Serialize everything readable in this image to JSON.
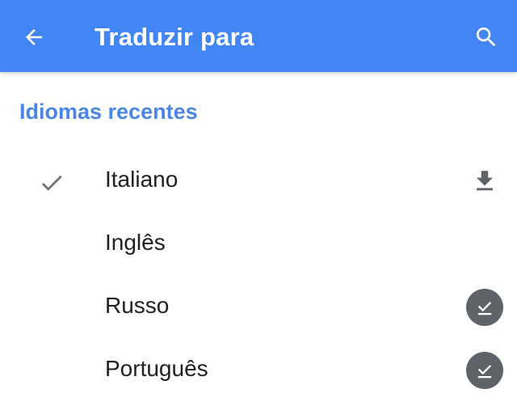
{
  "appbar": {
    "title": "Traduzir para",
    "back_icon": "arrow-back-icon",
    "search_icon": "search-icon",
    "background": "#4285f4"
  },
  "section": {
    "header": "Idiomas recentes",
    "header_color": "#4a86e8"
  },
  "languages": [
    {
      "label": "Italiano",
      "selected": true,
      "status": "download-available",
      "status_icon": "download-icon"
    },
    {
      "label": "Inglês",
      "selected": false,
      "status": "none"
    },
    {
      "label": "Russo",
      "selected": false,
      "status": "downloaded",
      "status_icon": "downloaded-check-icon"
    },
    {
      "label": "Português",
      "selected": false,
      "status": "downloaded",
      "status_icon": "downloaded-check-icon"
    }
  ]
}
